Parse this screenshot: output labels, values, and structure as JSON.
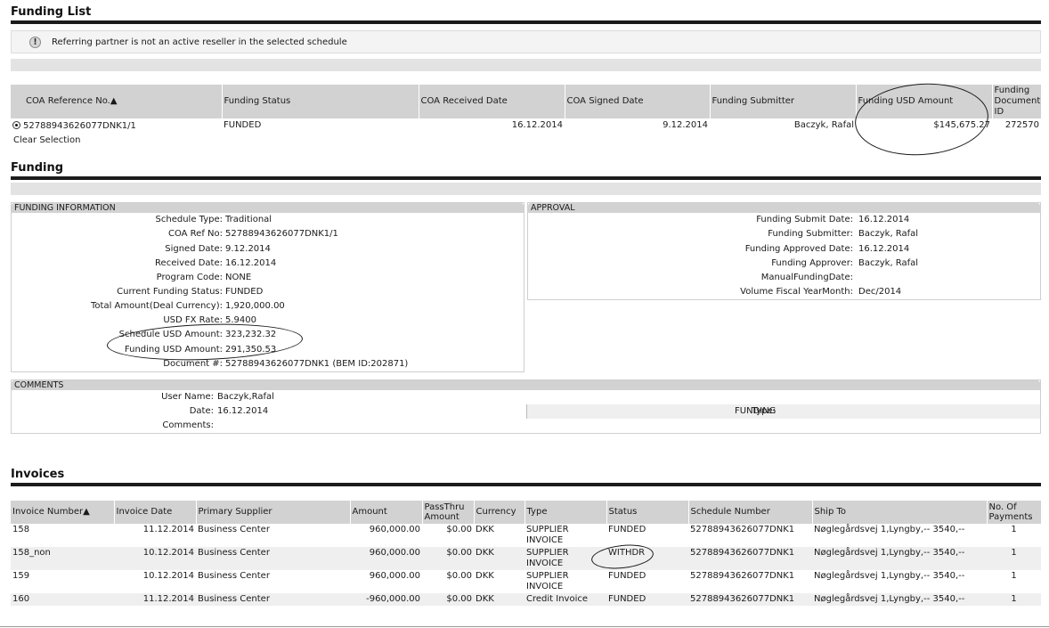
{
  "funding_list": {
    "title": "Funding List",
    "warning": "Referring partner is not an active reseller in the selected schedule",
    "headers": [
      "COA Reference No.▲",
      "Funding Status",
      "COA Received Date",
      "COA Signed Date",
      "Funding Submitter",
      "Funding USD Amount",
      "Funding Document ID"
    ],
    "row": {
      "coa_ref": "52788943626077DNK1/1",
      "status": "FUNDED",
      "received": "16.12.2014",
      "signed": "9.12.2014",
      "submitter": "Baczyk, Rafal",
      "usd_amount": "$145,675.27",
      "doc_id": "272570"
    },
    "clear_selection": "Clear Selection"
  },
  "funding": {
    "title": "Funding",
    "info_panel": {
      "header": "FUNDING INFORMATION",
      "rows": [
        {
          "label": "Schedule Type:",
          "value": "Traditional"
        },
        {
          "label": "COA Ref No:",
          "value": "52788943626077DNK1/1"
        },
        {
          "label": "Signed Date:",
          "value": "9.12.2014"
        },
        {
          "label": "Received Date:",
          "value": "16.12.2014"
        },
        {
          "label": "Program Code:",
          "value": "NONE"
        },
        {
          "label": "Current Funding Status:",
          "value": "FUNDED"
        },
        {
          "label": "Total Amount(Deal Currency):",
          "value": "1,920,000.00"
        },
        {
          "label": "USD FX Rate:",
          "value": "5.9400"
        },
        {
          "label": "Schedule USD Amount:",
          "value": "323,232.32"
        },
        {
          "label": "Funding USD Amount:",
          "value": "291,350.53"
        },
        {
          "label": "Document #:",
          "value": "52788943626077DNK1 (BEM ID:202871)"
        }
      ]
    },
    "approval_panel": {
      "header": "APPROVAL",
      "rows": [
        {
          "label": "Funding Submit Date:",
          "value": "16.12.2014"
        },
        {
          "label": "Funding Submitter:",
          "value": "Baczyk, Rafal"
        },
        {
          "label": "Funding Approved Date:",
          "value": "16.12.2014"
        },
        {
          "label": "Funding Approver:",
          "value": "Baczyk, Rafal"
        },
        {
          "label": "ManualFundingDate:",
          "value": ""
        },
        {
          "label": "Volume Fiscal YearMonth:",
          "value": "Dec/2014"
        }
      ]
    },
    "comments_panel": {
      "header": "COMMENTS",
      "user_label": "User Name:",
      "user_value": "Baczyk,Rafal",
      "date_label": "Date:",
      "date_value": "16.12.2014",
      "type_label": "Type:",
      "type_value": "FUNDING",
      "comments_label": "Comments:",
      "comments_value": ""
    }
  },
  "invoices": {
    "title": "Invoices",
    "headers": [
      "Invoice Number▲",
      "Invoice Date",
      "Primary Supplier",
      "Amount",
      "PassThru Amount",
      "Currency",
      "Type",
      "Status",
      "Schedule Number",
      "Ship To",
      "No. Of Payments"
    ],
    "rows": [
      [
        "158",
        "11.12.2014",
        "Business Center",
        "960,000.00",
        "$0.00",
        "DKK",
        "SUPPLIER INVOICE",
        "FUNDED",
        "52788943626077DNK1",
        "Nøglegårdsvej 1,Lyngby,-- 3540,--",
        "1"
      ],
      [
        "158_non",
        "10.12.2014",
        "Business Center",
        "960,000.00",
        "$0.00",
        "DKK",
        "SUPPLIER INVOICE",
        "WITHDR",
        "52788943626077DNK1",
        "Nøglegårdsvej 1,Lyngby,-- 3540,--",
        "1"
      ],
      [
        "159",
        "10.12.2014",
        "Business Center",
        "960,000.00",
        "$0.00",
        "DKK",
        "SUPPLIER INVOICE",
        "FUNDED",
        "52788943626077DNK1",
        "Nøglegårdsvej 1,Lyngby,-- 3540,--",
        "1"
      ],
      [
        "160",
        "11.12.2014",
        "Business Center",
        "-960,000.00",
        "$0.00",
        "DKK",
        "Credit Invoice",
        "FUNDED",
        "52788943626077DNK1",
        "Nøglegårdsvej 1,Lyngby,-- 3540,--",
        "1"
      ]
    ]
  }
}
